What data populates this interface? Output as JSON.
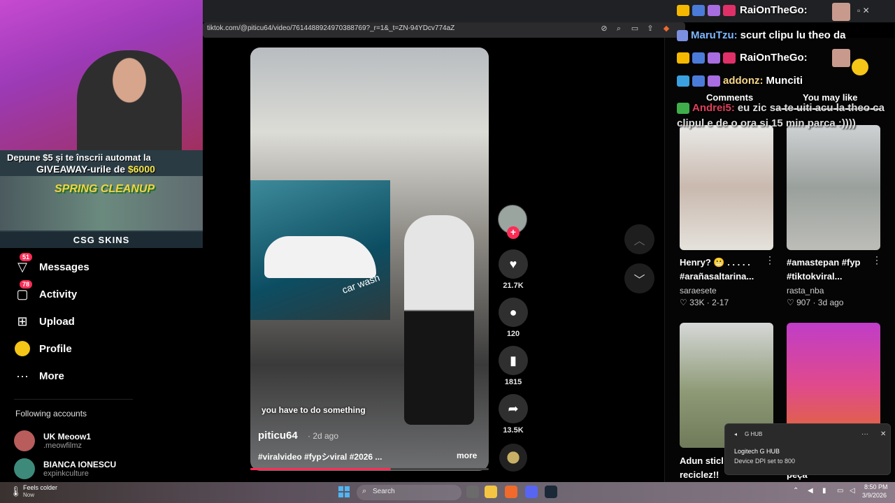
{
  "browser": {
    "url": "tiktok.com/@piticu64/video/7614488924970388769?_r=1&_t=ZN-94YDcv774aZ"
  },
  "stream_overlay": {
    "promo_line1": "Depune $5 și te înscrii automat la",
    "promo_line2_prefix": "GIVEAWAY-urile de ",
    "promo_amount": "$6000",
    "spring_title": "SPRING CLEANUP",
    "sponsor": "CSG SKINS"
  },
  "sidebar": {
    "items": [
      {
        "label": "Messages",
        "badge": "51",
        "icon": "paper-plane-icon"
      },
      {
        "label": "Activity",
        "badge": "78",
        "icon": "message-box-icon"
      },
      {
        "label": "Upload",
        "icon": "plus-square-icon"
      },
      {
        "label": "Profile",
        "icon": "profile-avatar-icon"
      },
      {
        "label": "More",
        "icon": "more-dots-icon"
      }
    ],
    "following_title": "Following accounts",
    "accounts": [
      {
        "name": "UK Meoow1",
        "handle": ".meowfilmz"
      },
      {
        "name": "BIANCA IONESCU",
        "handle": "expinkculture"
      }
    ]
  },
  "video": {
    "caption": "you have to do something",
    "username": "piticu64",
    "time": "· 2d ago",
    "tags": "#viralvideo #fypシviral #2026 ...",
    "more": "more",
    "progress": 0.59,
    "banner_text": "car wash"
  },
  "actions": {
    "likes": "21.7K",
    "comments": "120",
    "saves": "1815",
    "shares": "13.5K"
  },
  "right_panel": {
    "tabs": [
      "Comments",
      "You may like"
    ],
    "cards": [
      {
        "title": "Henry? 😬 . . . . . #arañasaltarina...",
        "user": "saraesete",
        "meta": "♡ 33K · 2-17"
      },
      {
        "title": "#amastepan #fyp #tiktokviral...",
        "user": "rasta_nba",
        "meta": "♡ 907 · 3d ago"
      },
      {
        "title": "Adun sticl reciclez!!",
        "user": "",
        "meta": ""
      },
      {
        "title": "peça",
        "user": "",
        "meta": ""
      }
    ]
  },
  "chat": [
    {
      "nick": "RaiOnTheGo:",
      "message": "",
      "color": "#ffffff"
    },
    {
      "nick": "MaruTzu:",
      "message": "scurt clipu lu theo da",
      "color": "#7fb7ff"
    },
    {
      "nick": "RaiOnTheGo:",
      "message": "",
      "color": "#ffffff"
    },
    {
      "nick": "addonz:",
      "message": "Munciti",
      "color": "#f5d68a"
    },
    {
      "nick": "Andrei5:",
      "message": "eu zic sa te uiti acu la theo ca clipul e de o ora si 15 min parca :))))",
      "color": "#e0405a"
    }
  ],
  "notification": {
    "app": "G HUB",
    "title": "Logitech G HUB",
    "body": "Device DPI set to 800"
  },
  "taskbar": {
    "weather": "Feels colder",
    "weather_sub": "Now",
    "search": "Search",
    "time": "8:50 PM",
    "date": "3/9/2026"
  },
  "colors": {
    "accent": "#fe2c55",
    "panel_bg": "#050505"
  }
}
